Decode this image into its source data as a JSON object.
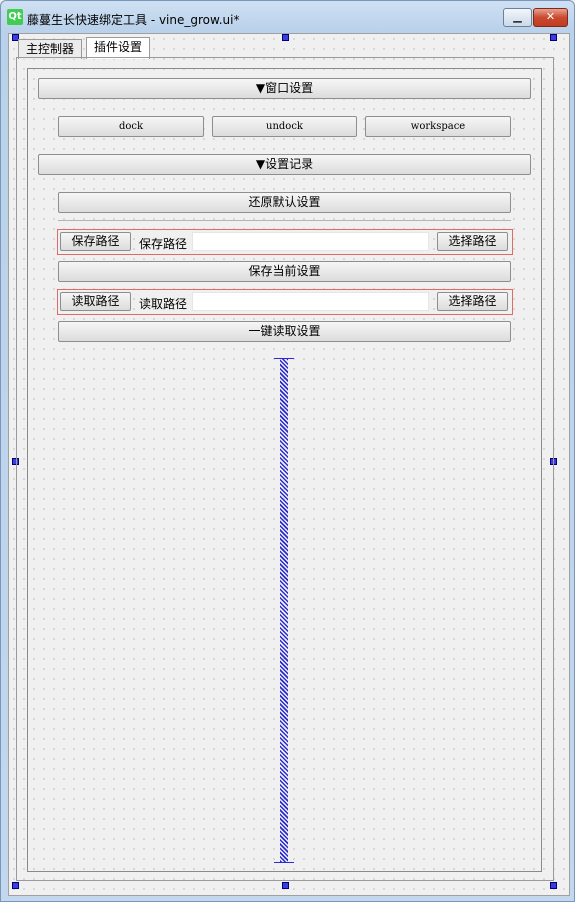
{
  "window": {
    "title": "藤蔓生长快速绑定工具 - vine_grow.ui*",
    "logo": "Qt",
    "minimize_glyph": "▁",
    "close_glyph": "✕"
  },
  "tabs": [
    {
      "label": "主控制器",
      "active": false
    },
    {
      "label": "插件设置",
      "active": true
    }
  ],
  "window_settings": {
    "header": "▼窗口设置",
    "buttons": [
      "dock",
      "undock",
      "workspace"
    ]
  },
  "settings_record": {
    "header": "▼设置记录",
    "restore_default": "还原默认设置",
    "save_row": {
      "button": "保存路径",
      "label": "保存路径",
      "value": "",
      "choose": "选择路径"
    },
    "save_current": "保存当前设置",
    "load_row": {
      "button": "读取路径",
      "label": "读取路径",
      "value": "",
      "choose": "选择路径"
    },
    "one_click_load": "一键读取设置"
  },
  "colors": {
    "selection_handle": "#3c3cdc",
    "spacer": "#2b2bd6",
    "layout_highlight": "#e06a6a"
  }
}
